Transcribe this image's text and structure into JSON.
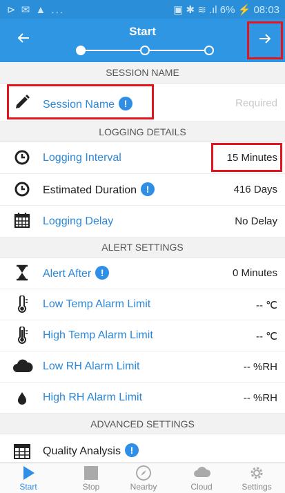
{
  "status_bar": {
    "left_icons": "⊳ ✉ ▲ ...",
    "right_text": "▣ ✱ ≋ .ıl 6% ⚡ 08:03"
  },
  "header": {
    "title": "Start",
    "back_icon": "arrow-left",
    "forward_icon": "arrow-right",
    "current_step": 1,
    "total_steps": 3
  },
  "sections": {
    "session_name": "SESSION NAME",
    "logging_details": "LOGGING DETAILS",
    "alert_settings": "ALERT SETTINGS",
    "advanced_settings": "ADVANCED SETTINGS"
  },
  "rows": {
    "session_name": {
      "label": "Session Name",
      "value": "Required",
      "icon": "pencil-icon"
    },
    "logging_interval": {
      "label": "Logging Interval",
      "value": "15 Minutes",
      "icon": "clock-icon"
    },
    "estimated_duration": {
      "label": "Estimated Duration",
      "value": "416 Days",
      "icon": "clock-icon"
    },
    "logging_delay": {
      "label": "Logging Delay",
      "value": "No Delay",
      "icon": "calendar-icon"
    },
    "alert_after": {
      "label": "Alert After",
      "value": "0 Minutes",
      "icon": "hourglass-icon"
    },
    "low_temp": {
      "label": "Low Temp Alarm Limit",
      "value": "-- ℃",
      "icon": "thermometer-low-icon"
    },
    "high_temp": {
      "label": "High Temp Alarm Limit",
      "value": "-- ℃",
      "icon": "thermometer-high-icon"
    },
    "low_rh": {
      "label": "Low RH Alarm Limit",
      "value": "-- %RH",
      "icon": "cloud-icon"
    },
    "high_rh": {
      "label": "High RH Alarm Limit",
      "value": "-- %RH",
      "icon": "droplet-icon"
    },
    "quality_analysis": {
      "label": "Quality Analysis",
      "icon": "grid-icon"
    }
  },
  "bottom_nav": [
    {
      "label": "Start",
      "icon": "play-icon",
      "active": true
    },
    {
      "label": "Stop",
      "icon": "stop-icon",
      "active": false
    },
    {
      "label": "Nearby",
      "icon": "compass-icon",
      "active": false
    },
    {
      "label": "Cloud",
      "icon": "cloud-icon",
      "active": false
    },
    {
      "label": "Settings",
      "icon": "gear-icon",
      "active": false
    }
  ],
  "colors": {
    "header": "#2f96e3",
    "accent": "#2b87d8",
    "highlight": "#e3141b"
  }
}
